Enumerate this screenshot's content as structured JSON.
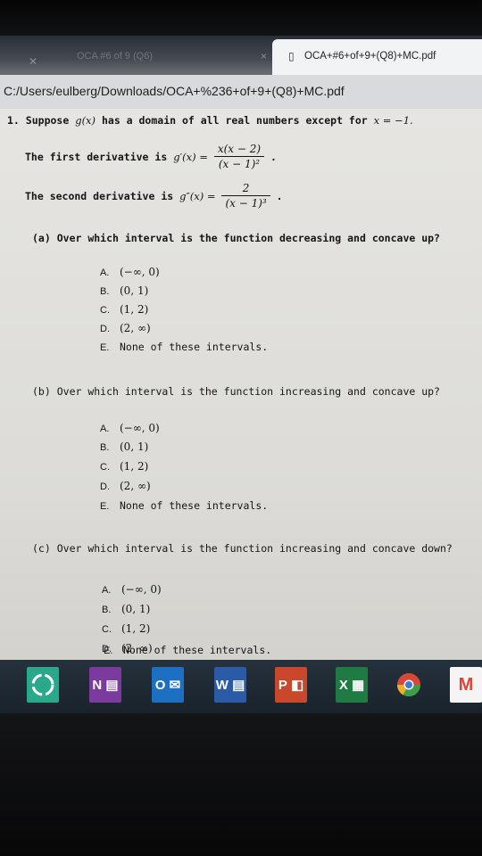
{
  "browser": {
    "inactive_tab": {
      "title": "OCA #6 of 9 (Q6)",
      "close": "×"
    },
    "active_tab": {
      "title": "OCA+#6+of+9+(Q8)+MC.pdf"
    },
    "address": "C:/Users/eulberg/Downloads/OCA+%236+of+9+(Q8)+MC.pdf"
  },
  "document": {
    "intro": {
      "number": "1.",
      "text_before": "Suppose",
      "function": "g(x)",
      "text_after": "has a domain of all real numbers except for",
      "exception": "x = −1."
    },
    "first_derivative": {
      "label": "The first derivative is",
      "lhs": "g′(x) =",
      "numerator": "x(x − 2)",
      "denominator": "(x − 1)²",
      "end": "."
    },
    "second_derivative": {
      "label": "The second derivative is",
      "lhs": "g″(x) =",
      "numerator": "2",
      "denominator": "(x − 1)³",
      "end": "."
    },
    "parts": [
      {
        "label": "(a)",
        "text": "Over which interval is the function decreasing and concave up?",
        "options": [
          {
            "letter": "A.",
            "value": "(−∞, 0)"
          },
          {
            "letter": "B.",
            "value": "(0, 1)"
          },
          {
            "letter": "C.",
            "value": "(1, 2)"
          },
          {
            "letter": "D.",
            "value": "(2, ∞)"
          },
          {
            "letter": "E.",
            "value": "None of these intervals."
          }
        ]
      },
      {
        "label": "(b)",
        "text": "Over which interval is the function increasing and concave up?",
        "options": [
          {
            "letter": "A.",
            "value": "(−∞, 0)"
          },
          {
            "letter": "B.",
            "value": "(0, 1)"
          },
          {
            "letter": "C.",
            "value": "(1, 2)"
          },
          {
            "letter": "D.",
            "value": "(2, ∞)"
          },
          {
            "letter": "E.",
            "value": "None of these intervals."
          }
        ]
      },
      {
        "label": "(c)",
        "text": "Over which interval is the function increasing and concave down?",
        "options": [
          {
            "letter": "A.",
            "value": "(−∞, 0)"
          },
          {
            "letter": "B.",
            "value": "(0, 1)"
          },
          {
            "letter": "C.",
            "value": "(1, 2)"
          },
          {
            "letter": "D.",
            "value": "(2, ∞)"
          },
          {
            "letter": "E.",
            "value": "None of these intervals."
          }
        ]
      }
    ]
  },
  "taskbar": {
    "apps": [
      {
        "name": "app-icon",
        "label": "",
        "color": "#2aa88b"
      },
      {
        "name": "onenote-icon",
        "label": "N",
        "color": "#7b3a9e"
      },
      {
        "name": "outlook-icon",
        "label": "O",
        "color": "#1c6fc1"
      },
      {
        "name": "word-icon",
        "label": "W",
        "color": "#2b5ba8"
      },
      {
        "name": "powerpoint-icon",
        "label": "P",
        "color": "#c9472b"
      },
      {
        "name": "excel-icon",
        "label": "X",
        "color": "#1f7a43"
      },
      {
        "name": "chrome-icon",
        "label": "",
        "color": "#e8b02c"
      },
      {
        "name": "gmail-icon",
        "label": "M",
        "color": "#d8473a"
      }
    ]
  }
}
